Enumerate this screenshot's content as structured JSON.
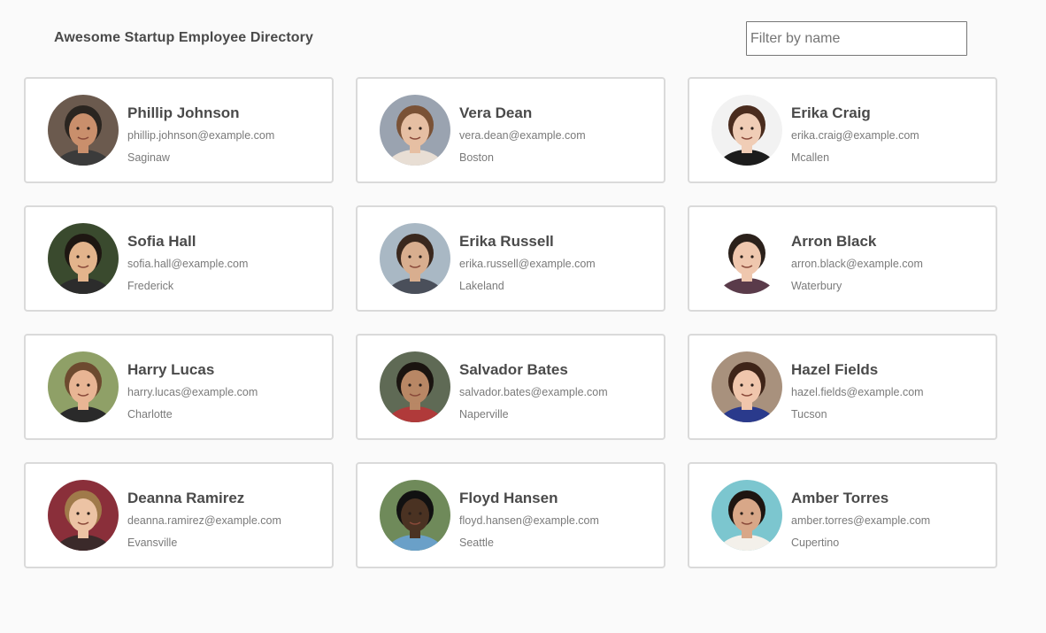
{
  "header": {
    "title": "Awesome Startup Employee Directory",
    "search_placeholder": "Filter by name",
    "search_value": ""
  },
  "employees": [
    {
      "name": "Phillip Johnson",
      "email": "phillip.johnson@example.com",
      "city": "Saginaw",
      "avatar": {
        "bg": "#6b5a4e",
        "skin": "#c98f6c",
        "hair": "#2a2520",
        "shirt": "#3b3b3b"
      }
    },
    {
      "name": "Vera Dean",
      "email": "vera.dean@example.com",
      "city": "Boston",
      "avatar": {
        "bg": "#9aa3b0",
        "skin": "#e6bfa3",
        "hair": "#7a5236",
        "shirt": "#e8ded4"
      }
    },
    {
      "name": "Erika Craig",
      "email": "erika.craig@example.com",
      "city": "Mcallen",
      "avatar": {
        "bg": "#f2f2f2",
        "skin": "#f0cdb6",
        "hair": "#4a2c1e",
        "shirt": "#1c1c1c"
      }
    },
    {
      "name": "Sofia Hall",
      "email": "sofia.hall@example.com",
      "city": "Frederick",
      "avatar": {
        "bg": "#3a4a2e",
        "skin": "#e3b48c",
        "hair": "#1e1712",
        "shirt": "#2c2c2c"
      }
    },
    {
      "name": "Erika Russell",
      "email": "erika.russell@example.com",
      "city": "Lakeland",
      "avatar": {
        "bg": "#a9b8c4",
        "skin": "#d8ae8f",
        "hair": "#3a281e",
        "shirt": "#4a4f5a"
      }
    },
    {
      "name": "Arron Black",
      "email": "arron.black@example.com",
      "city": "Waterbury",
      "avatar": {
        "bg": "#ffffff",
        "skin": "#efc7ae",
        "hair": "#2b211b",
        "shirt": "#5a3b4a"
      }
    },
    {
      "name": "Harry Lucas",
      "email": "harry.lucas@example.com",
      "city": "Charlotte",
      "avatar": {
        "bg": "#8fa067",
        "skin": "#e8b594",
        "hair": "#6d4a2f",
        "shirt": "#2a2a2a"
      }
    },
    {
      "name": "Salvador Bates",
      "email": "salvador.bates@example.com",
      "city": "Naperville",
      "avatar": {
        "bg": "#5f6a55",
        "skin": "#b88765",
        "hair": "#1a1410",
        "shirt": "#b03a3a"
      }
    },
    {
      "name": "Hazel Fields",
      "email": "hazel.fields@example.com",
      "city": "Tucson",
      "avatar": {
        "bg": "#a8917d",
        "skin": "#f0c6ac",
        "hair": "#3e2418",
        "shirt": "#2a3a8c"
      }
    },
    {
      "name": "Deanna Ramirez",
      "email": "deanna.ramirez@example.com",
      "city": "Evansville",
      "avatar": {
        "bg": "#8a2f3a",
        "skin": "#ecc3a4",
        "hair": "#a07a4a",
        "shirt": "#3b2a2a"
      }
    },
    {
      "name": "Floyd Hansen",
      "email": "floyd.hansen@example.com",
      "city": "Seattle",
      "avatar": {
        "bg": "#6f8a5a",
        "skin": "#4a3222",
        "hair": "#111111",
        "shirt": "#6aa0c8"
      }
    },
    {
      "name": "Amber Torres",
      "email": "amber.torres@example.com",
      "city": "Cupertino",
      "avatar": {
        "bg": "#7cc6cf",
        "skin": "#d8a788",
        "hair": "#1e1511",
        "shirt": "#f3f0ea"
      }
    }
  ]
}
